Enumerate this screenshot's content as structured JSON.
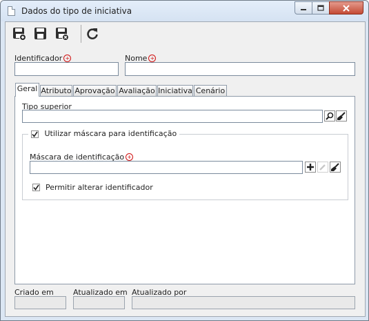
{
  "window": {
    "title": "Dados do tipo de iniciativa"
  },
  "toolbar": {
    "save_new_icon": "save-new-icon",
    "save_icon": "save-icon",
    "save_close_icon": "save-close-icon",
    "refresh_icon": "refresh-icon"
  },
  "fields": {
    "identificador_label": "Identificador",
    "identificador_value": "",
    "nome_label": "Nome",
    "nome_value": ""
  },
  "tabs": [
    {
      "label": "Geral"
    },
    {
      "label": "Atributo"
    },
    {
      "label": "Aprovação"
    },
    {
      "label": "Avaliação"
    },
    {
      "label": "Iniciativa"
    },
    {
      "label": "Cenário"
    }
  ],
  "geral": {
    "tipo_superior_label": "Tipo superior",
    "tipo_superior_value": "",
    "usar_mascara_label": "Utilizar máscara para identificação",
    "usar_mascara_checked": true,
    "mascara_label": "Máscara de identificação",
    "mascara_value": "",
    "permitir_alterar_label": "Permitir alterar identificador",
    "permitir_alterar_checked": true
  },
  "footer": {
    "criado_em_label": "Criado em",
    "criado_em_value": "",
    "atualizado_em_label": "Atualizado em",
    "atualizado_em_value": "",
    "atualizado_por_label": "Atualizado por",
    "atualizado_por_value": ""
  },
  "colors": {
    "required": "#d01010",
    "window_frame": "#dbe6f3",
    "close_button": "#c44b35"
  }
}
